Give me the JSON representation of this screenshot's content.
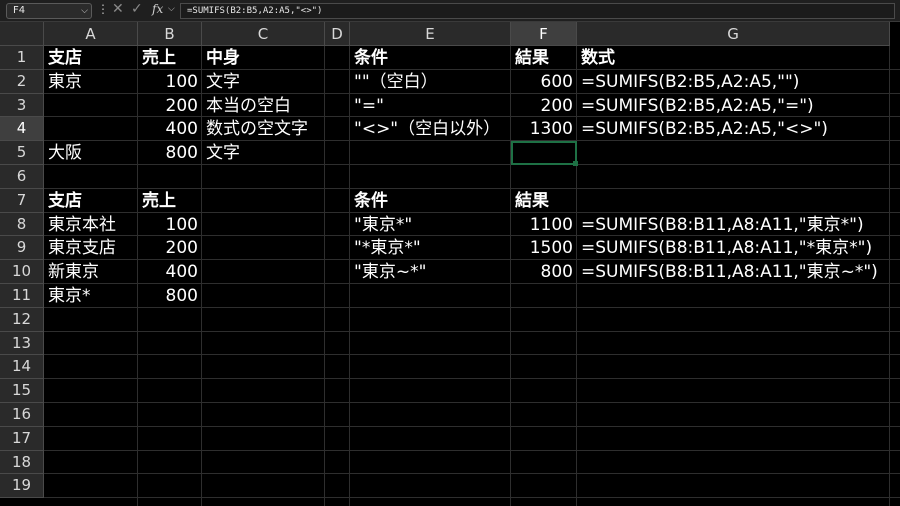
{
  "formula_bar": {
    "name_box": "F4",
    "dots": "⋮",
    "cancel": "✕",
    "enter": "✓",
    "fx": "fx",
    "formula": "=SUMIFS(B2:B5,A2:A5,\"<>\")"
  },
  "columns": [
    "A",
    "B",
    "C",
    "D",
    "E",
    "F",
    "G"
  ],
  "active_column": "F",
  "rows": [
    "1",
    "2",
    "3",
    "4",
    "5",
    "6",
    "7",
    "8",
    "9",
    "10",
    "11",
    "12",
    "13",
    "14",
    "15",
    "16",
    "17",
    "18",
    "19"
  ],
  "active_row": "4",
  "cells": {
    "A1": "支店",
    "B1": "売上",
    "C1": "中身",
    "E1": "条件",
    "F1": "結果",
    "G1": "数式",
    "A2": "東京",
    "B2": "100",
    "C2": "文字",
    "E2": "\"\"（空白）",
    "F2": "600",
    "G2": "=SUMIFS(B2:B5,A2:A5,\"\")",
    "B3": "200",
    "C3": "本当の空白",
    "E3": "\"=\"",
    "F3": "200",
    "G3": "=SUMIFS(B2:B5,A2:A5,\"=\")",
    "B4": "400",
    "C4": "数式の空文字",
    "E4": "\"<>\"（空白以外）",
    "F4": "1300",
    "G4": "=SUMIFS(B2:B5,A2:A5,\"<>\")",
    "A5": "大阪",
    "B5": "800",
    "C5": "文字",
    "A7": "支店",
    "B7": "売上",
    "E7": "条件",
    "F7": "結果",
    "A8": "東京本社",
    "B8": "100",
    "E8": "\"東京*\"",
    "F8": "1100",
    "G8": "=SUMIFS(B8:B11,A8:A11,\"東京*\")",
    "A9": "東京支店",
    "B9": "200",
    "E9": "\"*東京*\"",
    "F9": "1500",
    "G9": "=SUMIFS(B8:B11,A8:A11,\"*東京*\")",
    "A10": "新東京",
    "B10": "400",
    "E10": "\"東京~*\"",
    "F10": "800",
    "G10": "=SUMIFS(B8:B11,A8:A11,\"東京~*\")",
    "A11": "東京*",
    "B11": "800"
  },
  "colors": {
    "selection": "#1e7145",
    "header_bg": "#2a2a2a",
    "grid_bg": "#000000",
    "text": "#ffffff"
  }
}
